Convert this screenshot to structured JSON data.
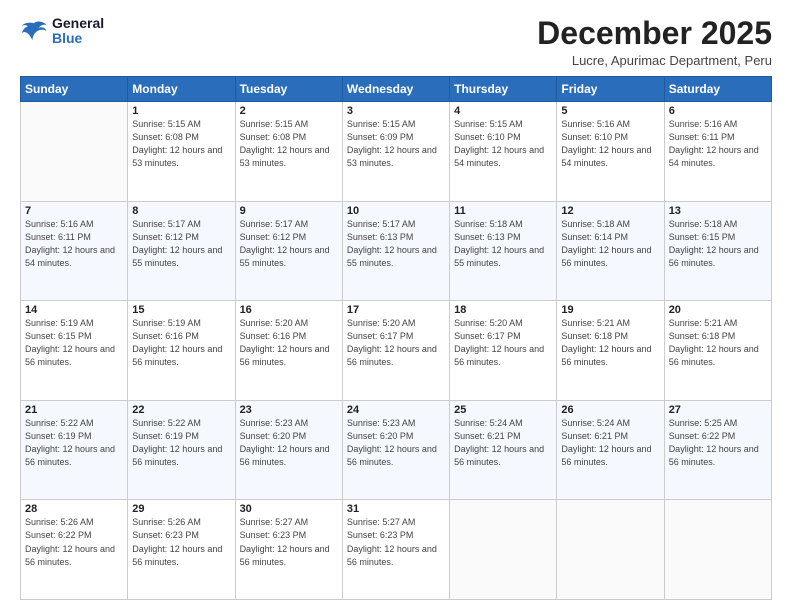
{
  "header": {
    "logo_general": "General",
    "logo_blue": "Blue",
    "month_title": "December 2025",
    "location": "Lucre, Apurimac Department, Peru"
  },
  "days_of_week": [
    "Sunday",
    "Monday",
    "Tuesday",
    "Wednesday",
    "Thursday",
    "Friday",
    "Saturday"
  ],
  "weeks": [
    [
      {
        "day": "",
        "sunrise": "",
        "sunset": "",
        "daylight": ""
      },
      {
        "day": "1",
        "sunrise": "Sunrise: 5:15 AM",
        "sunset": "Sunset: 6:08 PM",
        "daylight": "Daylight: 12 hours and 53 minutes."
      },
      {
        "day": "2",
        "sunrise": "Sunrise: 5:15 AM",
        "sunset": "Sunset: 6:08 PM",
        "daylight": "Daylight: 12 hours and 53 minutes."
      },
      {
        "day": "3",
        "sunrise": "Sunrise: 5:15 AM",
        "sunset": "Sunset: 6:09 PM",
        "daylight": "Daylight: 12 hours and 53 minutes."
      },
      {
        "day": "4",
        "sunrise": "Sunrise: 5:15 AM",
        "sunset": "Sunset: 6:10 PM",
        "daylight": "Daylight: 12 hours and 54 minutes."
      },
      {
        "day": "5",
        "sunrise": "Sunrise: 5:16 AM",
        "sunset": "Sunset: 6:10 PM",
        "daylight": "Daylight: 12 hours and 54 minutes."
      },
      {
        "day": "6",
        "sunrise": "Sunrise: 5:16 AM",
        "sunset": "Sunset: 6:11 PM",
        "daylight": "Daylight: 12 hours and 54 minutes."
      }
    ],
    [
      {
        "day": "7",
        "sunrise": "Sunrise: 5:16 AM",
        "sunset": "Sunset: 6:11 PM",
        "daylight": "Daylight: 12 hours and 54 minutes."
      },
      {
        "day": "8",
        "sunrise": "Sunrise: 5:17 AM",
        "sunset": "Sunset: 6:12 PM",
        "daylight": "Daylight: 12 hours and 55 minutes."
      },
      {
        "day": "9",
        "sunrise": "Sunrise: 5:17 AM",
        "sunset": "Sunset: 6:12 PM",
        "daylight": "Daylight: 12 hours and 55 minutes."
      },
      {
        "day": "10",
        "sunrise": "Sunrise: 5:17 AM",
        "sunset": "Sunset: 6:13 PM",
        "daylight": "Daylight: 12 hours and 55 minutes."
      },
      {
        "day": "11",
        "sunrise": "Sunrise: 5:18 AM",
        "sunset": "Sunset: 6:13 PM",
        "daylight": "Daylight: 12 hours and 55 minutes."
      },
      {
        "day": "12",
        "sunrise": "Sunrise: 5:18 AM",
        "sunset": "Sunset: 6:14 PM",
        "daylight": "Daylight: 12 hours and 56 minutes."
      },
      {
        "day": "13",
        "sunrise": "Sunrise: 5:18 AM",
        "sunset": "Sunset: 6:15 PM",
        "daylight": "Daylight: 12 hours and 56 minutes."
      }
    ],
    [
      {
        "day": "14",
        "sunrise": "Sunrise: 5:19 AM",
        "sunset": "Sunset: 6:15 PM",
        "daylight": "Daylight: 12 hours and 56 minutes."
      },
      {
        "day": "15",
        "sunrise": "Sunrise: 5:19 AM",
        "sunset": "Sunset: 6:16 PM",
        "daylight": "Daylight: 12 hours and 56 minutes."
      },
      {
        "day": "16",
        "sunrise": "Sunrise: 5:20 AM",
        "sunset": "Sunset: 6:16 PM",
        "daylight": "Daylight: 12 hours and 56 minutes."
      },
      {
        "day": "17",
        "sunrise": "Sunrise: 5:20 AM",
        "sunset": "Sunset: 6:17 PM",
        "daylight": "Daylight: 12 hours and 56 minutes."
      },
      {
        "day": "18",
        "sunrise": "Sunrise: 5:20 AM",
        "sunset": "Sunset: 6:17 PM",
        "daylight": "Daylight: 12 hours and 56 minutes."
      },
      {
        "day": "19",
        "sunrise": "Sunrise: 5:21 AM",
        "sunset": "Sunset: 6:18 PM",
        "daylight": "Daylight: 12 hours and 56 minutes."
      },
      {
        "day": "20",
        "sunrise": "Sunrise: 5:21 AM",
        "sunset": "Sunset: 6:18 PM",
        "daylight": "Daylight: 12 hours and 56 minutes."
      }
    ],
    [
      {
        "day": "21",
        "sunrise": "Sunrise: 5:22 AM",
        "sunset": "Sunset: 6:19 PM",
        "daylight": "Daylight: 12 hours and 56 minutes."
      },
      {
        "day": "22",
        "sunrise": "Sunrise: 5:22 AM",
        "sunset": "Sunset: 6:19 PM",
        "daylight": "Daylight: 12 hours and 56 minutes."
      },
      {
        "day": "23",
        "sunrise": "Sunrise: 5:23 AM",
        "sunset": "Sunset: 6:20 PM",
        "daylight": "Daylight: 12 hours and 56 minutes."
      },
      {
        "day": "24",
        "sunrise": "Sunrise: 5:23 AM",
        "sunset": "Sunset: 6:20 PM",
        "daylight": "Daylight: 12 hours and 56 minutes."
      },
      {
        "day": "25",
        "sunrise": "Sunrise: 5:24 AM",
        "sunset": "Sunset: 6:21 PM",
        "daylight": "Daylight: 12 hours and 56 minutes."
      },
      {
        "day": "26",
        "sunrise": "Sunrise: 5:24 AM",
        "sunset": "Sunset: 6:21 PM",
        "daylight": "Daylight: 12 hours and 56 minutes."
      },
      {
        "day": "27",
        "sunrise": "Sunrise: 5:25 AM",
        "sunset": "Sunset: 6:22 PM",
        "daylight": "Daylight: 12 hours and 56 minutes."
      }
    ],
    [
      {
        "day": "28",
        "sunrise": "Sunrise: 5:26 AM",
        "sunset": "Sunset: 6:22 PM",
        "daylight": "Daylight: 12 hours and 56 minutes."
      },
      {
        "day": "29",
        "sunrise": "Sunrise: 5:26 AM",
        "sunset": "Sunset: 6:23 PM",
        "daylight": "Daylight: 12 hours and 56 minutes."
      },
      {
        "day": "30",
        "sunrise": "Sunrise: 5:27 AM",
        "sunset": "Sunset: 6:23 PM",
        "daylight": "Daylight: 12 hours and 56 minutes."
      },
      {
        "day": "31",
        "sunrise": "Sunrise: 5:27 AM",
        "sunset": "Sunset: 6:23 PM",
        "daylight": "Daylight: 12 hours and 56 minutes."
      },
      {
        "day": "",
        "sunrise": "",
        "sunset": "",
        "daylight": ""
      },
      {
        "day": "",
        "sunrise": "",
        "sunset": "",
        "daylight": ""
      },
      {
        "day": "",
        "sunrise": "",
        "sunset": "",
        "daylight": ""
      }
    ]
  ]
}
